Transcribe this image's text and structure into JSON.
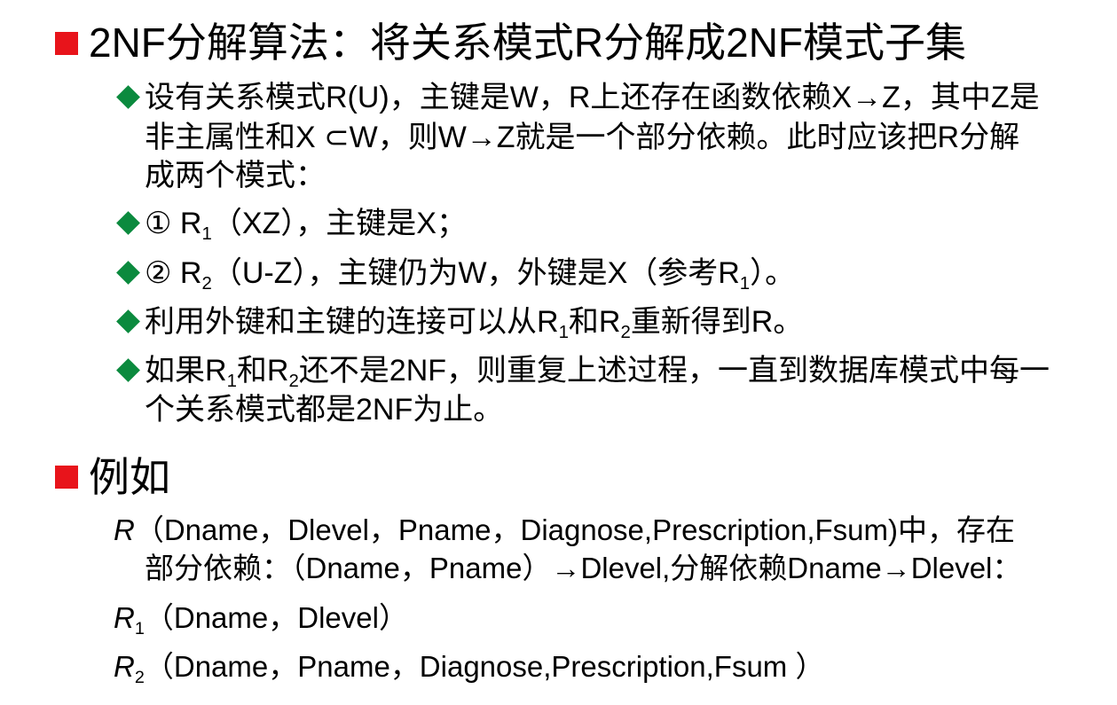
{
  "colors": {
    "heading_bullet": "#e8141b",
    "list_bullet": "#0b8a3e",
    "text": "#000000",
    "background": "#ffffff"
  },
  "icons": {
    "heading_bullet": "red-square-bullet-icon",
    "list_bullet": "green-diamond-bullet-icon"
  },
  "algorithm": {
    "heading": "2NF分解算法：将关系模式R分解成2NF模式子集",
    "bullet1": [
      "设有关系模式R(U)，主键是W，R上还存在函数依赖X→Z，其中Z是",
      "非主属性和X ⊂W，则W→Z就是一个部分依赖。此时应该把R分解",
      "成两个模式："
    ],
    "bullet2": [
      "① R",
      "1",
      "（XZ），主键是X；"
    ],
    "bullet3": [
      "② R",
      "2",
      "（U-Z），主键仍为W，外键是X（参考R",
      "1",
      "）。"
    ],
    "bullet4": [
      "利用外键和主键的连接可以从R",
      "1",
      "和R",
      "2",
      "重新得到R。"
    ],
    "bullet5": {
      "line1": [
        "如果R",
        "1",
        "和R",
        "2",
        "还不是2NF，则重复上述过程，一直到数据库模式中每一"
      ],
      "line2": "个关系模式都是2NF为止。"
    }
  },
  "example": {
    "heading": "例如",
    "relation": {
      "name": "R",
      "attrs": "（Dname，Dlevel，Pname，Diagnose,Prescription,Fsum)中，存在"
    },
    "dependency": "部分依赖：（Dname，Pname）→Dlevel,分解依赖Dname→Dlevel：",
    "r1": {
      "name": "R",
      "sub": "1",
      "attrs": "（Dname，Dlevel）"
    },
    "r2": {
      "name": "R",
      "sub": "2",
      "attrs": "（Dname，Pname，Diagnose,Prescription,Fsum ）"
    }
  }
}
